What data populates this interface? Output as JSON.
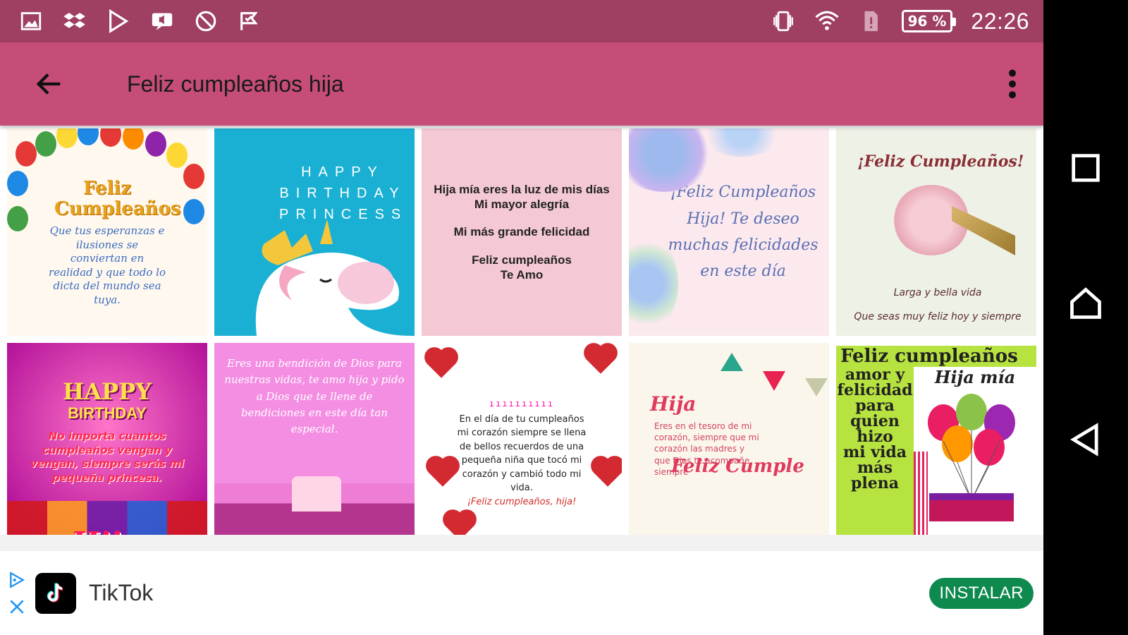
{
  "status_bar": {
    "time": "22:26",
    "battery": "96 %",
    "left_icons": [
      "image-icon",
      "dropbox-icon",
      "play-store-icon",
      "sound-notification-icon",
      "no-disturb-icon",
      "flag-check-icon"
    ],
    "right_icons": [
      "vibrate-icon",
      "wifi-icon",
      "no-sim-icon",
      "battery-icon"
    ]
  },
  "app_bar": {
    "title": "Feliz cumpleaños hija",
    "back_icon": "arrow-back-icon",
    "menu_icon": "more-vertical-icon",
    "color": "#c54d78"
  },
  "grid": {
    "cards": [
      {
        "title": "Feliz Cumpleaños",
        "message": "Que tus esperanzas e ilusiones se conviertan en realidad y que todo lo dicta del mundo sea tuya."
      },
      {
        "title": "HAPPY BIRTHDAY PRINCESS"
      },
      {
        "lines": [
          "Hija mía eres la luz de mis días",
          "Mi mayor alegría",
          "Mi más grande felicidad",
          "Feliz cumpleaños",
          "Te Amo"
        ]
      },
      {
        "message": "¡Feliz Cumpleaños Hija! Te deseo muchas felicidades en este día"
      },
      {
        "title": "¡Feliz Cumpleaños!",
        "line1": "Larga y bella vida",
        "line2": "Que seas muy feliz hoy y siempre"
      },
      {
        "title": "HAPPY",
        "title2": "BIRTHDAY",
        "message": "No importa cuantos cumpleaños vengan y vengan, siempre serás mi pequeña princesa.",
        "footer": "Hija"
      },
      {
        "message": "Eres una bendición de Dios para nuestras vidas, te amo hija y pido a Dios que te llene de bendiciones en este día tan especial."
      },
      {
        "message": "En el día de tu cumpleaños mi corazón siempre se llena de bellos recuerdos de una pequeña niña que tocó mi corazón y cambió todo mi vida.",
        "closing": "¡Feliz cumpleaños, hija!"
      },
      {
        "title": "Hija",
        "message": "Eres en el tesoro de mi corazón, siempre que mi corazón las madres y que Dios te acompañe siempre",
        "sign": "Feliz Cumple"
      },
      {
        "title": "Feliz cumpleaños",
        "sub": "Hija mía",
        "side_words": [
          "amor y",
          "felicidad",
          "para",
          "quien",
          "hizo",
          "mi vida",
          "más",
          "plena"
        ]
      }
    ]
  },
  "ad": {
    "name": "TikTok",
    "button": "INSTALAR",
    "button_color": "#0f8a4f"
  },
  "nav_bar": {
    "buttons": [
      "recents-icon",
      "home-icon",
      "back-triangle-icon"
    ]
  }
}
